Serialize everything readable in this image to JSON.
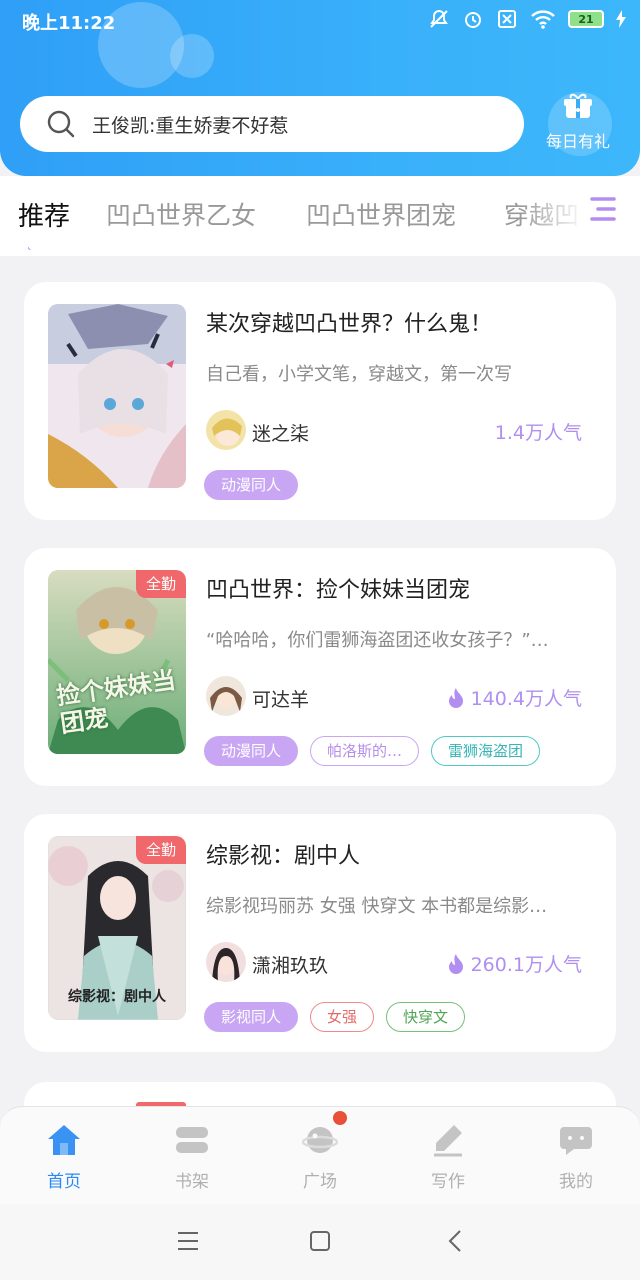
{
  "status_bar": {
    "time": "晚上11:22",
    "battery": "21"
  },
  "search": {
    "placeholder": "王俊凯:重生娇妻不好惹"
  },
  "gift": {
    "label": "每日有礼"
  },
  "tabs": [
    "推荐",
    "凹凸世界乙女",
    "凹凸世界团宠",
    "穿越凹"
  ],
  "books": [
    {
      "title": "某次穿越凹凸世界？什么鬼！",
      "desc": "自己看，小学文笔，穿越文，第一次写",
      "author": "迷之柒",
      "popularity": "1.4万人气",
      "badge": "",
      "tags": [
        "动漫同人"
      ]
    },
    {
      "title": "凹凸世界：捡个妹妹当团宠",
      "desc": "“哈哈哈，你们雷狮海盗团还收女孩子？”…",
      "author": "可达羊",
      "popularity": "140.4万人气",
      "badge": "全勤",
      "tags": [
        "动漫同人",
        "帕洛斯的…",
        "雷狮海盗团"
      ],
      "cover_text": "捡个妹妹当团宠"
    },
    {
      "title": "综影视：剧中人",
      "desc": "综影视玛丽苏 女强 快穿文 本书都是综影…",
      "author": "潇湘玖玖",
      "popularity": "260.1万人气",
      "badge": "全勤",
      "tags": [
        "影视同人",
        "女强",
        "快穿文"
      ],
      "cover_text": "综影视：剧中人"
    }
  ],
  "bottom_nav": [
    "首页",
    "书架",
    "广场",
    "写作",
    "我的"
  ],
  "colors": {
    "accent": "#2a8af3",
    "purple": "#b08ff0",
    "badge": "#f0686b"
  }
}
